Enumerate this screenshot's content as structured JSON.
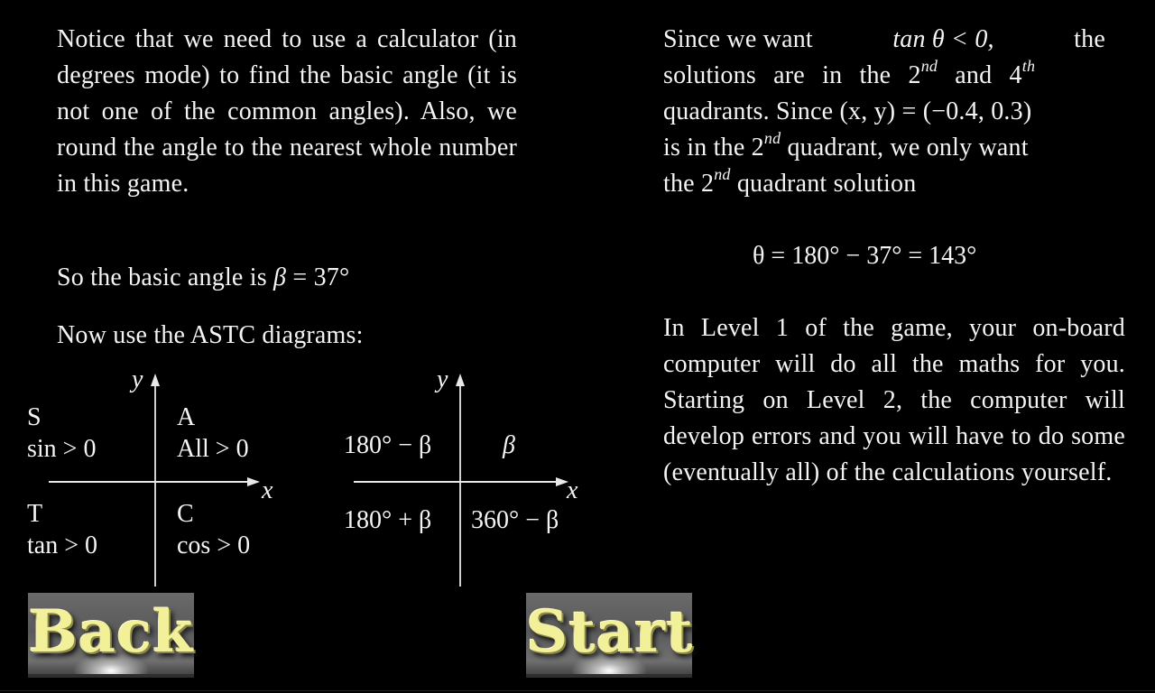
{
  "left_panel": {
    "intro_paragraph": "Notice that we need to use a calculator (in degrees mode) to find the basic angle (it is not one of the common angles). Also, we round the angle to the nearest whole number in this game.",
    "basic_angle_text": "So the basic angle is ",
    "basic_angle_symbol": "β",
    "basic_angle_value": " = 37°",
    "astc_intro": "Now use the ASTC diagrams:"
  },
  "astc_diagram": {
    "x_label": "x",
    "y_label": "y",
    "quadrants": {
      "q2_letter": "S",
      "q2_rule": "sin > 0",
      "q1_letter": "A",
      "q1_rule": "All > 0",
      "q3_letter": "T",
      "q3_rule": "tan > 0",
      "q4_letter": "C",
      "q4_rule": "cos > 0"
    }
  },
  "angle_diagram": {
    "x_label": "x",
    "y_label": "y",
    "q2": "180° − β",
    "q1": "β",
    "q3": "180° + β",
    "q4": "360° − β"
  },
  "right_panel": {
    "line1_a": "Since we want ",
    "line1_math": "tan θ < 0,",
    "line1_b": " the",
    "line2_a": "solutions are in the 2",
    "sup_nd": "nd",
    "line2_b": " and 4",
    "sup_th": "th",
    "line3_a": "quadrants. Since ",
    "line3_math": "(x, y) = (−0.4, 0.3)",
    "line4_a": "is in the 2",
    "line4_b": " quadrant, we only want",
    "line5_a": "the 2",
    "line5_b": " quadrant solution",
    "equation": "θ = 180° − 37° = 143°",
    "level_paragraph": "In Level 1 of the game, your on-board computer will do all the maths for you.  Starting on Level 2, the computer will develop errors and you will have to do some (eventually all) of the calculations yourself."
  },
  "buttons": {
    "back_label": "Back",
    "start_label": "Start"
  }
}
